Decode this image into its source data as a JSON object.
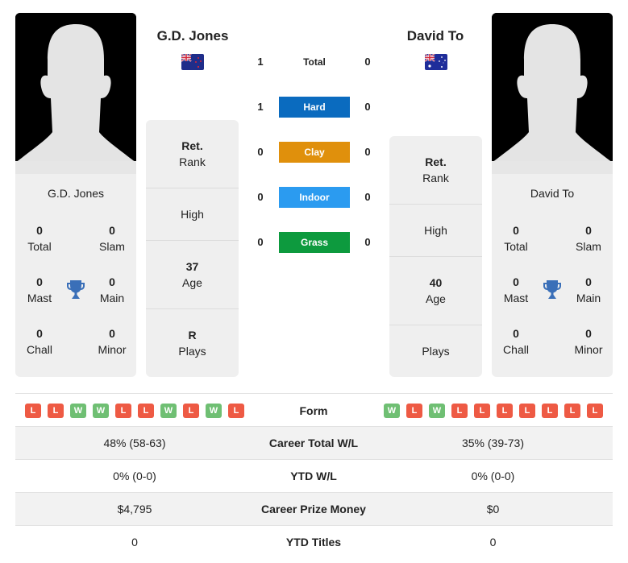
{
  "players": [
    {
      "name": "G.D. Jones",
      "country": "New Zealand",
      "flag_icon": "nz-flag-icon",
      "titles": {
        "total": "0",
        "slam": "0",
        "mast": "0",
        "main": "0",
        "chall": "0",
        "minor": "0"
      },
      "labels": {
        "total": "Total",
        "slam": "Slam",
        "mast": "Mast",
        "main": "Main",
        "chall": "Chall",
        "minor": "Minor"
      },
      "info": {
        "rank_value": "Ret.",
        "rank_label": "Rank",
        "high_value": "",
        "high_label": "High",
        "age_value": "37",
        "age_label": "Age",
        "plays_value": "R",
        "plays_label": "Plays"
      },
      "form": [
        "L",
        "L",
        "W",
        "W",
        "L",
        "L",
        "W",
        "L",
        "W",
        "L"
      ]
    },
    {
      "name": "David To",
      "country": "Australia",
      "flag_icon": "au-flag-icon",
      "titles": {
        "total": "0",
        "slam": "0",
        "mast": "0",
        "main": "0",
        "chall": "0",
        "minor": "0"
      },
      "labels": {
        "total": "Total",
        "slam": "Slam",
        "mast": "Mast",
        "main": "Main",
        "chall": "Chall",
        "minor": "Minor"
      },
      "info": {
        "rank_value": "Ret.",
        "rank_label": "Rank",
        "high_value": "",
        "high_label": "High",
        "age_value": "40",
        "age_label": "Age",
        "plays_value": "",
        "plays_label": "Plays"
      },
      "form": [
        "W",
        "L",
        "W",
        "L",
        "L",
        "L",
        "L",
        "L",
        "L",
        "L"
      ]
    }
  ],
  "h2h": [
    {
      "label": "Total",
      "left": "1",
      "right": "0",
      "color": ""
    },
    {
      "label": "Hard",
      "left": "1",
      "right": "0",
      "color": "#0a6bbf"
    },
    {
      "label": "Clay",
      "left": "0",
      "right": "0",
      "color": "#e0900c"
    },
    {
      "label": "Indoor",
      "left": "0",
      "right": "0",
      "color": "#2b9bf0"
    },
    {
      "label": "Grass",
      "left": "0",
      "right": "0",
      "color": "#0d9a3e"
    }
  ],
  "form_label": "Form",
  "stats": [
    {
      "label": "Career Total W/L",
      "left": "48% (58-63)",
      "right": "35% (39-73)"
    },
    {
      "label": "YTD W/L",
      "left": "0% (0-0)",
      "right": "0% (0-0)"
    },
    {
      "label": "Career Prize Money",
      "left": "$4,795",
      "right": "$0"
    },
    {
      "label": "YTD Titles",
      "left": "0",
      "right": "0"
    }
  ],
  "colors": {
    "win": "#6fbf73",
    "loss": "#ee5a44",
    "trophy": "#3a6fb8"
  }
}
